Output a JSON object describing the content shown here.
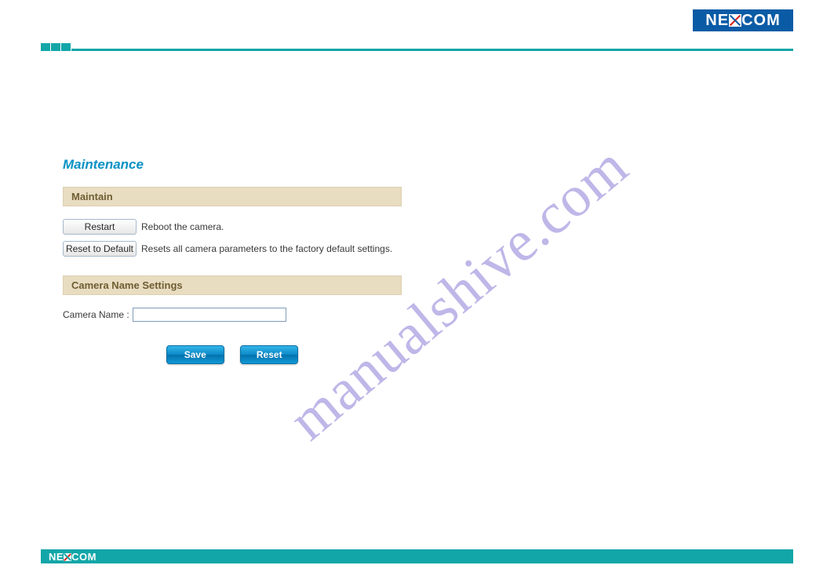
{
  "brand": "NEXCOM",
  "page_title": "Maintenance",
  "watermark": "manualshive.com",
  "sections": {
    "maintain": {
      "header": "Maintain",
      "restart_btn": "Restart",
      "restart_desc": "Reboot the camera.",
      "reset_btn": "Reset to Default",
      "reset_desc": "Resets all camera parameters to the factory default settings."
    },
    "camera_name": {
      "header": "Camera Name Settings",
      "label": "Camera Name :",
      "value": ""
    }
  },
  "actions": {
    "save": "Save",
    "reset": "Reset"
  }
}
